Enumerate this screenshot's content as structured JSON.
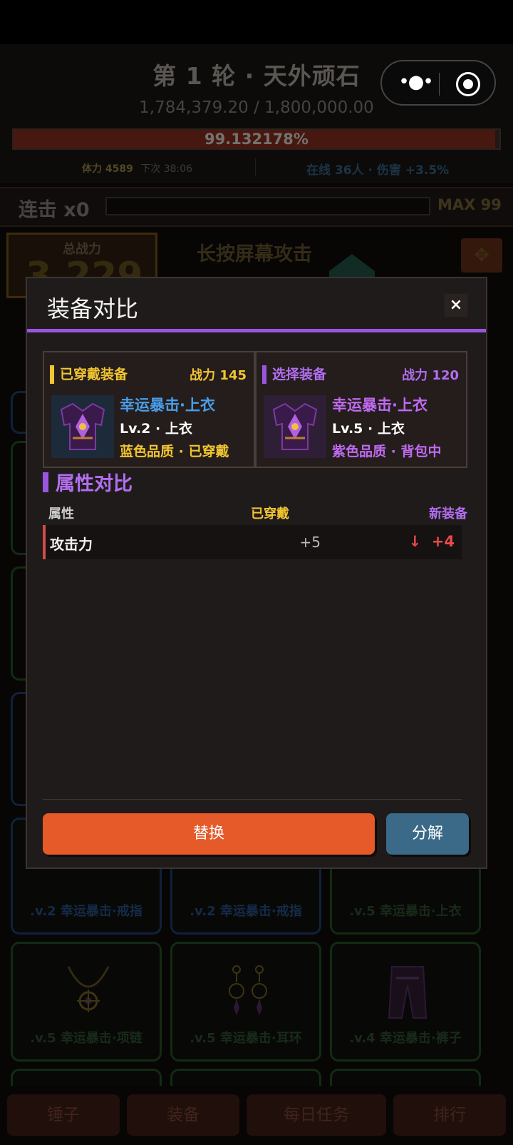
{
  "header": {
    "round_title": "第 1 轮  ·  天外顽石",
    "hp_text": "1,784,379.20 / 1,800,000.00",
    "hp_percent": "99.132178%",
    "hp_fraction": 0.99132178,
    "stamina_label": "体力 4589",
    "next_label": "下次 38:06",
    "online_text": "在线 36人 · 伤害 +3.5%"
  },
  "combo": {
    "label": "连击 x0",
    "max": "MAX 99"
  },
  "power": {
    "label": "总战力",
    "value": "3,229"
  },
  "press_hint": "长按屏幕攻击",
  "grid": {
    "cards": [
      {
        "label": ".v.2 幸运暴击·戒指"
      },
      {
        "label": ".v.2 幸运暴击·戒指"
      },
      {
        "label": ".v.5 幸运暴击·上衣"
      },
      {
        "label": ".v.5 幸运暴击·项链"
      },
      {
        "label": ".v.5 幸运暴击·耳环"
      },
      {
        "label": ".v.4 幸运暴击·裤子"
      }
    ]
  },
  "bottom_nav": {
    "items": [
      "锤子",
      "装备",
      "每日任务",
      "排行"
    ]
  },
  "modal": {
    "title": "装备对比",
    "close": "×",
    "current": {
      "heading": "已穿戴装备",
      "power": "战力 145",
      "name": "幸运暴击·上衣",
      "level": "Lv.2 · 上衣",
      "quality": "蓝色品质 · 已穿戴"
    },
    "selected": {
      "heading": "选择装备",
      "power": "战力 120",
      "name": "幸运暴击·上衣",
      "level": "Lv.5 · 上衣",
      "quality": "紫色品质 · 背包中"
    },
    "section_title": "属性对比",
    "table": {
      "col_attr": "属性",
      "col_worn": "已穿戴",
      "col_new": "新装备",
      "rows": [
        {
          "name": "攻击力",
          "worn": "+5",
          "arrow": "↓",
          "new": "+4"
        }
      ]
    },
    "replace_label": "替换",
    "decompose_label": "分解"
  },
  "colors": {
    "accent_purple": "#9a55e0",
    "gold": "#f2c531",
    "blue_item": "#4a9ee8",
    "purple_item": "#c06af0",
    "replace_orange": "#e65a2a",
    "decompose_blue": "#3a6a88",
    "decrease_red": "#e84a4a"
  }
}
